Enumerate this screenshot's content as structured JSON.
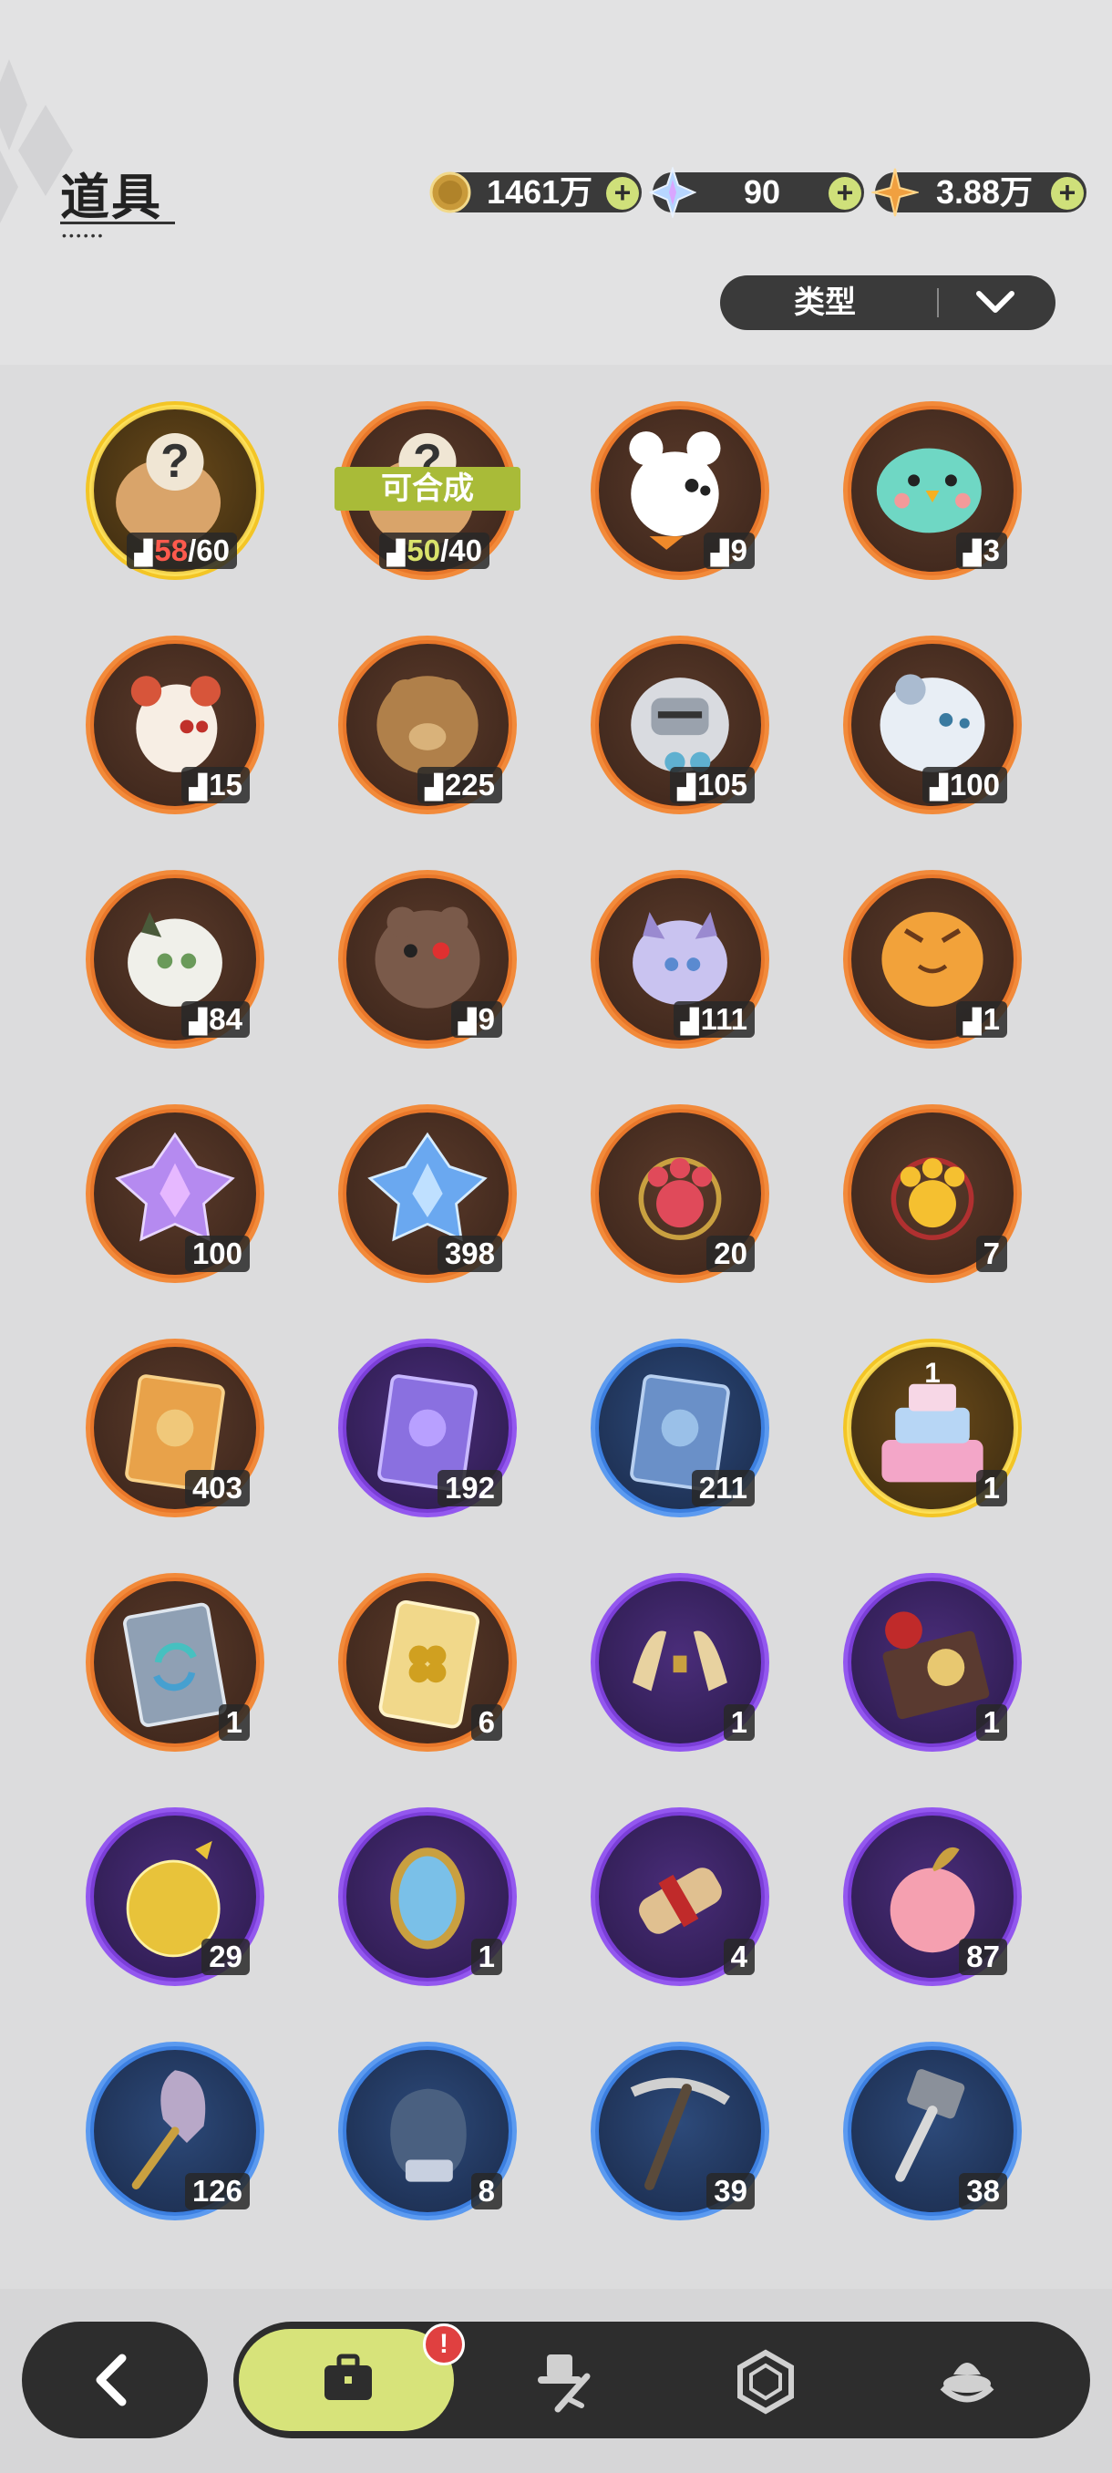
{
  "header": {
    "title": "道具",
    "title_dots": "••••••"
  },
  "currencies": [
    {
      "name": "coin",
      "icon": "coin-icon",
      "value": "1461万",
      "plus": "+"
    },
    {
      "name": "crystal",
      "icon": "crystal-icon",
      "value": "90",
      "plus": "+"
    },
    {
      "name": "star",
      "icon": "star-shard-icon",
      "value": "3.88万",
      "plus": "+"
    }
  ],
  "filter": {
    "label": "类型",
    "icon": "chevron-down-icon"
  },
  "compose_badge": "可合成",
  "count_prefix_icon": "puzzle-piece-icon",
  "items": [
    {
      "row": 0,
      "col": 0,
      "rarity": "gold",
      "art": "mystery-fragment",
      "owned": "58",
      "required": "60",
      "owned_color": "red"
    },
    {
      "row": 0,
      "col": 1,
      "rarity": "orange",
      "art": "mystery-fragment",
      "owned": "50",
      "required": "40",
      "owned_color": "yellow",
      "badge": true
    },
    {
      "row": 0,
      "col": 2,
      "rarity": "orange",
      "art": "white-bear-fragment",
      "count": "9",
      "fragment": true
    },
    {
      "row": 0,
      "col": 3,
      "rarity": "orange",
      "art": "teal-bird-fragment",
      "count": "3",
      "fragment": true
    },
    {
      "row": 1,
      "col": 0,
      "rarity": "orange",
      "art": "fox-fragment",
      "count": "15",
      "fragment": true
    },
    {
      "row": 1,
      "col": 1,
      "rarity": "orange",
      "art": "brown-bear-fragment",
      "count": "225",
      "fragment": true
    },
    {
      "row": 1,
      "col": 2,
      "rarity": "orange",
      "art": "knight-fragment",
      "count": "105",
      "fragment": true
    },
    {
      "row": 1,
      "col": 3,
      "rarity": "orange",
      "art": "white-cat-fragment",
      "count": "100",
      "fragment": true
    },
    {
      "row": 2,
      "col": 0,
      "rarity": "orange",
      "art": "green-cat-fragment",
      "count": "84",
      "fragment": true
    },
    {
      "row": 2,
      "col": 1,
      "rarity": "orange",
      "art": "dark-bear-fragment",
      "count": "9",
      "fragment": true
    },
    {
      "row": 2,
      "col": 2,
      "rarity": "orange",
      "art": "purple-cat-fragment",
      "count": "111",
      "fragment": true
    },
    {
      "row": 2,
      "col": 3,
      "rarity": "orange",
      "art": "tiger-fragment",
      "count": "1",
      "fragment": true
    },
    {
      "row": 3,
      "col": 0,
      "rarity": "orange",
      "art": "pink-crystal",
      "count": "100"
    },
    {
      "row": 3,
      "col": 1,
      "rarity": "orange",
      "art": "blue-crystal",
      "count": "398"
    },
    {
      "row": 3,
      "col": 2,
      "rarity": "orange",
      "art": "red-paw-charm",
      "count": "20"
    },
    {
      "row": 3,
      "col": 3,
      "rarity": "orange",
      "art": "gold-paw-charm",
      "count": "7"
    },
    {
      "row": 4,
      "col": 0,
      "rarity": "orange",
      "art": "gold-card",
      "count": "403"
    },
    {
      "row": 4,
      "col": 1,
      "rarity": "purple",
      "art": "purple-card",
      "count": "192"
    },
    {
      "row": 4,
      "col": 2,
      "rarity": "blue",
      "art": "blue-card",
      "count": "211"
    },
    {
      "row": 4,
      "col": 3,
      "rarity": "gold",
      "art": "birthday-cake",
      "count": "1",
      "cake_label": "1"
    },
    {
      "row": 5,
      "col": 0,
      "rarity": "orange",
      "art": "refresh-book",
      "count": "1"
    },
    {
      "row": 5,
      "col": 1,
      "rarity": "orange",
      "art": "clover-ticket",
      "count": "6"
    },
    {
      "row": 5,
      "col": 2,
      "rarity": "purple",
      "art": "gold-horns",
      "count": "1"
    },
    {
      "row": 5,
      "col": 3,
      "rarity": "purple",
      "art": "gift-box",
      "count": "1"
    },
    {
      "row": 6,
      "col": 0,
      "rarity": "purple",
      "art": "gold-bag",
      "count": "29"
    },
    {
      "row": 6,
      "col": 1,
      "rarity": "purple",
      "art": "magic-mirror",
      "count": "1"
    },
    {
      "row": 6,
      "col": 2,
      "rarity": "purple",
      "art": "scroll",
      "count": "4"
    },
    {
      "row": 6,
      "col": 3,
      "rarity": "purple",
      "art": "pink-apple",
      "count": "87"
    },
    {
      "row": 7,
      "col": 0,
      "rarity": "blue",
      "art": "shovel",
      "count": "126"
    },
    {
      "row": 7,
      "col": 1,
      "rarity": "blue",
      "art": "glove",
      "count": "8"
    },
    {
      "row": 7,
      "col": 2,
      "rarity": "blue",
      "art": "pickaxe",
      "count": "39"
    },
    {
      "row": 7,
      "col": 3,
      "rarity": "blue",
      "art": "hammer",
      "count": "38"
    }
  ],
  "bottom_nav": {
    "back_icon": "back-arrow-icon",
    "tabs": [
      {
        "name": "bag",
        "icon": "bag-icon",
        "active": true,
        "alert": "!"
      },
      {
        "name": "equipment",
        "icon": "hat-sword-icon"
      },
      {
        "name": "gem",
        "icon": "hexagon-gem-icon"
      },
      {
        "name": "dessert",
        "icon": "dessert-icon"
      }
    ]
  },
  "colors": {
    "accent": "#d7e37a",
    "dark": "#2d2d2d",
    "gold_ring": "#f3c526",
    "orange_ring": "#f28a3a",
    "purple_ring": "#9357ef",
    "blue_ring": "#5b9af0"
  }
}
